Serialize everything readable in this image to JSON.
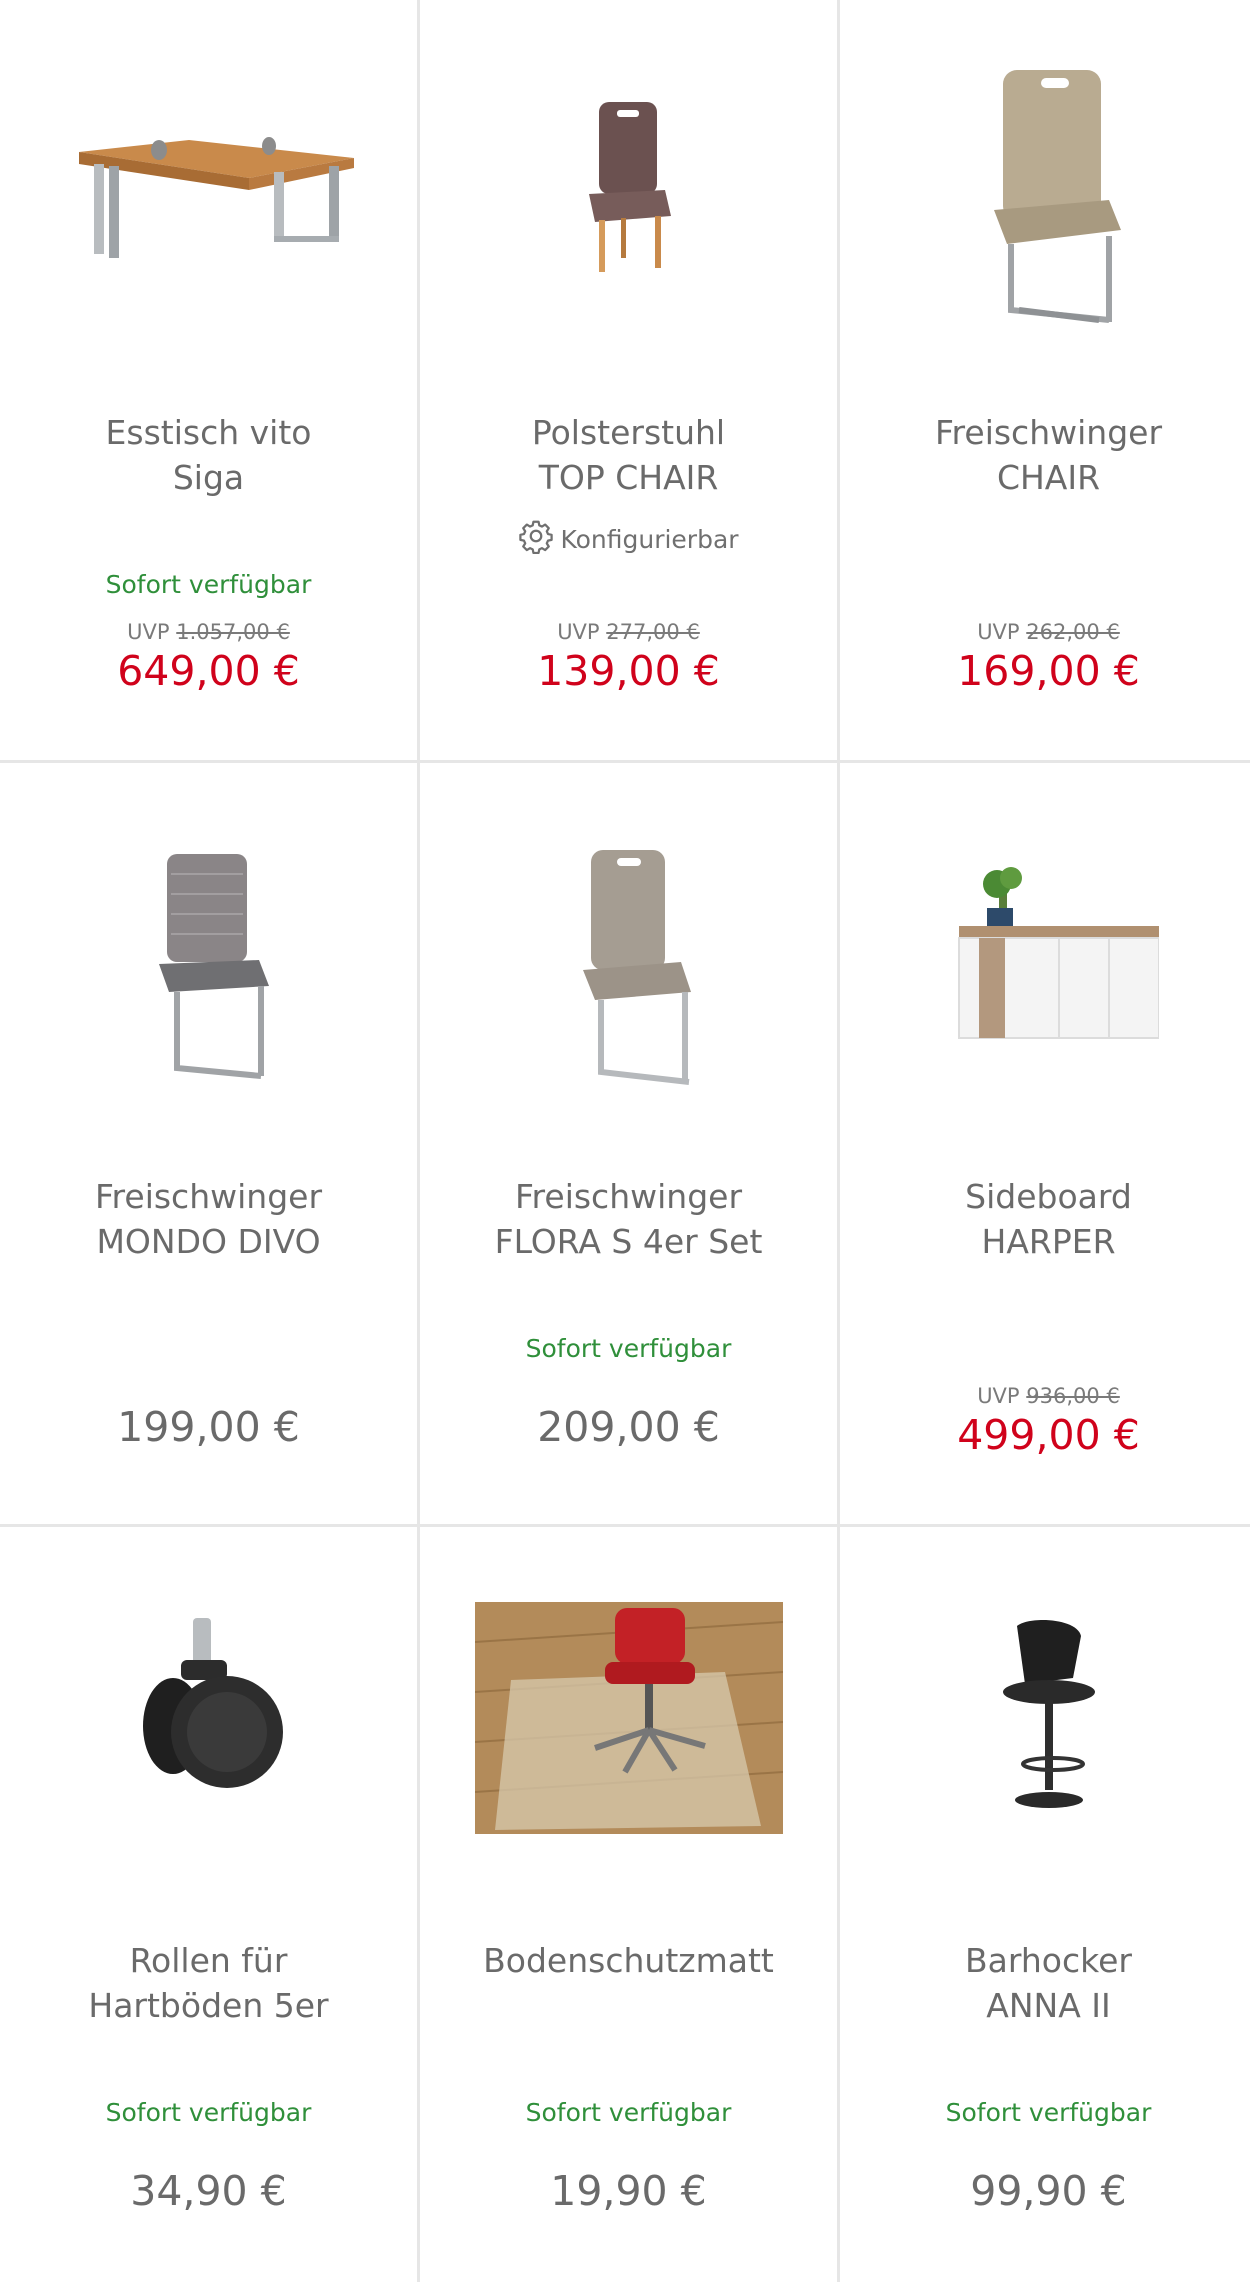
{
  "colors": {
    "sale_price": "#d0021b",
    "availability": "#2f8f3a",
    "text": "#6a6a6a",
    "divider": "#e6e6e6"
  },
  "products": [
    {
      "title_lines": [
        "Esstisch vito",
        "Siga"
      ],
      "image": "dining-table-image",
      "availability": "Sofort verfügbar",
      "uvp_label": "UVP",
      "uvp_price": "1.057,00 €",
      "price": "649,00 €"
    },
    {
      "title_lines": [
        "Polsterstuhl",
        "TOP CHAIR"
      ],
      "image": "upholstered-chair-image",
      "configurable": "Konfigurierbar",
      "uvp_label": "UVP",
      "uvp_price": "277,00 €",
      "price": "139,00 €"
    },
    {
      "title_lines": [
        "Freischwinger",
        "CHAIR"
      ],
      "image": "cantilever-chair-beige-image",
      "uvp_label": "UVP",
      "uvp_price": "262,00 €",
      "price": "169,00 €"
    },
    {
      "title_lines": [
        "Freischwinger",
        "MONDO DIVO"
      ],
      "image": "cantilever-chair-grey-image",
      "price": "199,00 €"
    },
    {
      "title_lines": [
        "Freischwinger",
        "FLORA S 4er Set"
      ],
      "image": "cantilever-chair-taupe-image",
      "availability": "Sofort verfügbar",
      "price": "209,00 €"
    },
    {
      "title_lines": [
        "Sideboard",
        "HARPER"
      ],
      "image": "sideboard-image",
      "uvp_label": "UVP",
      "uvp_price": "936,00 €",
      "price": "499,00 €"
    },
    {
      "title_lines": [
        "Rollen für",
        "Hartböden 5er"
      ],
      "image": "caster-wheel-image",
      "availability": "Sofort verfügbar",
      "price": "34,90 €"
    },
    {
      "title_lines": [
        "Bodenschutzmatt",
        ""
      ],
      "image": "floor-protection-mat-image",
      "availability": "Sofort verfügbar",
      "price": "19,90 €"
    },
    {
      "title_lines": [
        "Barhocker",
        "ANNA II"
      ],
      "image": "bar-stool-image",
      "availability": "Sofort verfügbar",
      "price": "99,90 €"
    }
  ]
}
